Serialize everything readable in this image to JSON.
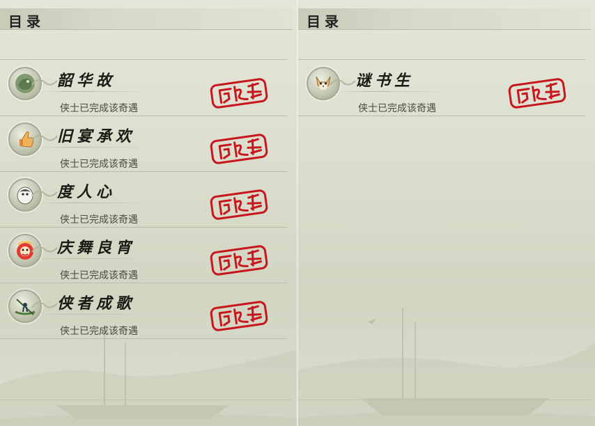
{
  "book": {
    "left_page": {
      "header_title": "目录",
      "entries": [
        {
          "title": "韶华故",
          "status": "侠士已完成该奇遇",
          "icon": "jade-dragon-icon",
          "stamp": "completed-seal-stamp"
        },
        {
          "title": "旧宴承欢",
          "status": "侠士已完成该奇遇",
          "icon": "thumbs-up-icon",
          "stamp": "completed-seal-stamp"
        },
        {
          "title": "度人心",
          "status": "侠士已完成该奇遇",
          "icon": "white-bird-icon",
          "stamp": "completed-seal-stamp"
        },
        {
          "title": "庆舞良宵",
          "status": "侠士已完成该奇遇",
          "icon": "lion-dance-icon",
          "stamp": "completed-seal-stamp"
        },
        {
          "title": "侠者成歌",
          "status": "侠士已完成该奇遇",
          "icon": "boatman-icon",
          "stamp": "completed-seal-stamp"
        }
      ]
    },
    "right_page": {
      "header_title": "目录",
      "entries": [
        {
          "title": "谜书生",
          "status": "侠士已完成该奇遇",
          "icon": "fox-scholar-icon",
          "stamp": "completed-seal-stamp"
        }
      ]
    }
  },
  "colors": {
    "paper": "#dadccb",
    "header_band": "#c8cbb8",
    "seal_red": "#c8161d",
    "title_text": "#1b1b16",
    "status_text": "#4a4a40",
    "divider": "#b9bca8"
  }
}
